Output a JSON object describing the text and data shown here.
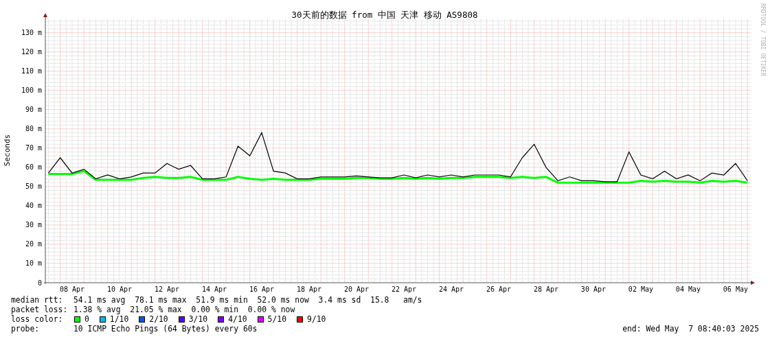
{
  "graph": {
    "title": "30天前的数据 from 中国 天津 移动 AS9808",
    "credit": "RRDTOOL / TOBI OETIKER",
    "chart_data": {
      "type": "line",
      "ylabel": "Seconds",
      "categories": [
        null,
        null,
        "08 Apr",
        null,
        null,
        null,
        "10 Apr",
        null,
        null,
        null,
        "12 Apr",
        null,
        null,
        null,
        "14 Apr",
        null,
        null,
        null,
        "16 Apr",
        null,
        null,
        null,
        "18 Apr",
        null,
        null,
        null,
        "20 Apr",
        null,
        null,
        null,
        "22 Apr",
        null,
        null,
        null,
        "24 Apr",
        null,
        null,
        null,
        "26 Apr",
        null,
        null,
        null,
        "28 Apr",
        null,
        null,
        null,
        "30 Apr",
        null,
        null,
        null,
        "02 May",
        null,
        null,
        null,
        "04 May",
        null,
        null,
        null,
        "06 May",
        null
      ],
      "series": [
        {
          "color": "#00ff00",
          "values": [
            56.5,
            56.5,
            56.5,
            58,
            53.5,
            53.5,
            53.5,
            53.5,
            54.5,
            55,
            54.5,
            54.5,
            55,
            53.5,
            53.5,
            53.5,
            55,
            54,
            53.5,
            54,
            53.5,
            53.5,
            53.5,
            54,
            54,
            54,
            54.5,
            54.5,
            54,
            54,
            54.5,
            54,
            54.5,
            54,
            54.5,
            54.5,
            55,
            55,
            55,
            54.5,
            55,
            54.5,
            55,
            52,
            52,
            52,
            52,
            52,
            52,
            52,
            53,
            52.5,
            53,
            52.5,
            52.5,
            52,
            53,
            52.5,
            53,
            52
          ]
        },
        {
          "color": "#000000",
          "values": [
            57,
            65,
            57,
            59,
            54,
            56,
            54,
            55,
            57,
            57,
            62,
            59,
            61,
            54,
            54,
            55,
            71,
            66,
            78,
            58,
            57,
            54,
            54,
            55,
            55,
            55,
            55.5,
            55,
            54.5,
            54.5,
            56,
            54.5,
            56,
            55,
            56,
            55,
            56,
            56,
            56,
            55,
            65,
            72,
            60,
            53,
            55,
            53,
            53,
            52.5,
            52.5,
            68,
            56,
            54,
            58,
            54,
            56,
            53,
            57,
            56,
            62,
            53
          ]
        }
      ],
      "ylim": [
        0,
        137
      ],
      "grid": true,
      "yticks": [
        {
          "value": 0,
          "label": "0"
        },
        {
          "value": 10,
          "label": "10 m"
        },
        {
          "value": 20,
          "label": "20 m"
        },
        {
          "value": 30,
          "label": "30 m"
        },
        {
          "value": 40,
          "label": "40 m"
        },
        {
          "value": 50,
          "label": "50 m"
        },
        {
          "value": 60,
          "label": "60 m"
        },
        {
          "value": 70,
          "label": "70 m"
        },
        {
          "value": 80,
          "label": "80 m"
        },
        {
          "value": 90,
          "label": "90 m"
        },
        {
          "value": 100,
          "label": "100 m"
        },
        {
          "value": 110,
          "label": "110 m"
        },
        {
          "value": 120,
          "label": "120 m"
        },
        {
          "value": 130,
          "label": "130 m"
        }
      ]
    }
  },
  "stats": [
    {
      "label": "median rtt:",
      "value": "54.1 ms avg  78.1 ms max  51.9 ms min  52.0 ms now  3.4 ms sd  15.8   am/s"
    },
    {
      "label": "packet loss:",
      "value": "1.38 % avg  21.05 % max  0.00 % min  0.00 % now"
    }
  ],
  "loss_color": {
    "label": "loss color:",
    "items": [
      {
        "label": "0",
        "color": "#00ff00"
      },
      {
        "label": "1/10",
        "color": "#00b8ff"
      },
      {
        "label": "2/10",
        "color": "#0059ff"
      },
      {
        "label": "3/10",
        "color": "#5e00ff"
      },
      {
        "label": "4/10",
        "color": "#7e00ff"
      },
      {
        "label": "5/10",
        "color": "#dd00ff"
      },
      {
        "label": "9/10",
        "color": "#ff0000"
      }
    ]
  },
  "probe": {
    "label": "probe:",
    "value": "10 ICMP Echo Pings (64 Bytes) every 60s"
  },
  "end": "end: Wed May  7 08:40:03 2025"
}
